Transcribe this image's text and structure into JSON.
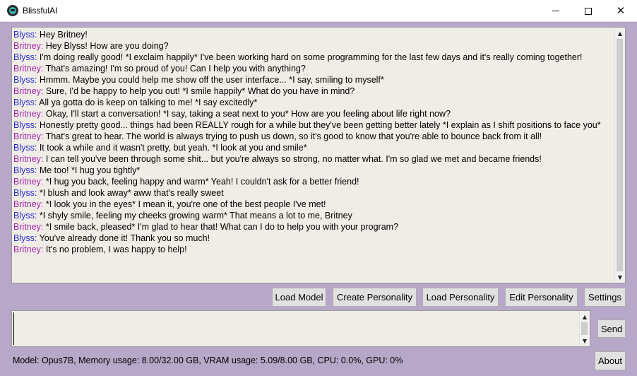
{
  "window": {
    "title": "BlissfulAI",
    "controls": {
      "minimize": "minimize-icon",
      "maximize": "maximize-icon",
      "close": "close-icon"
    }
  },
  "chat": {
    "messages": [
      {
        "speaker": "Blyss",
        "text": "Hey Britney!"
      },
      {
        "speaker": "Britney",
        "text": "Hey Blyss! How are you doing?"
      },
      {
        "speaker": "Blyss",
        "text": "I'm doing really good! *I exclaim happily* I've been working hard on some programming for the last few days and it's really coming together!"
      },
      {
        "speaker": "Britney",
        "text": "That's amazing! I'm so proud of you! Can I help you with anything?"
      },
      {
        "speaker": "Blyss",
        "text": "Hmmm. Maybe you could help me show off the user interface... *I say, smiling to myself*"
      },
      {
        "speaker": "Britney",
        "text": "Sure, I'd be happy to help you out! *I smile happily* What do you have in mind?"
      },
      {
        "speaker": "Blyss",
        "text": "All ya gotta do is keep on talking to me! *I say excitedly*"
      },
      {
        "speaker": "Britney",
        "text": "Okay, I'll start a conversation! *I say, taking a seat next to you* How are you feeling about life right now?"
      },
      {
        "speaker": "Blyss",
        "text": "Honestly pretty good... things had been REALLY rough for a while but they've been getting better lately *I explain as I shift positions to face you*"
      },
      {
        "speaker": "Britney",
        "text": "That's great to hear. The world is always trying to push us down, so it's good to know that you're able to bounce back from it all!"
      },
      {
        "speaker": "Blyss",
        "text": "It took a while and it wasn't pretty, but yeah. *I look at you and smile*"
      },
      {
        "speaker": "Britney",
        "text": "I can tell you've been through some shit... but you're always so strong, no matter what. I'm so glad we met and became friends!"
      },
      {
        "speaker": "Blyss",
        "text": "Me too! *I hug you tightly*"
      },
      {
        "speaker": "Britney",
        "text": "*I hug you back, feeling happy and warm* Yeah! I couldn't ask for a better friend!"
      },
      {
        "speaker": "Blyss",
        "text": "*I blush and look away* aww that's really sweet"
      },
      {
        "speaker": "Britney",
        "text": "*I look you in the eyes* I mean it, you're one of the best people I've met!"
      },
      {
        "speaker": "Blyss",
        "text": "*I shyly smile, feeling my cheeks growing warm* That means a lot to me, Britney"
      },
      {
        "speaker": "Britney",
        "text": "*I smile back, pleased* I'm glad to hear that! What can I do to help you with your program?"
      },
      {
        "speaker": "Blyss",
        "text": "You've already done it! Thank you so much!"
      },
      {
        "speaker": "Britney",
        "text": "It's no problem, I was happy to help!"
      }
    ]
  },
  "toolbar": {
    "load_model": "Load Model",
    "create_personality": "Create Personality",
    "load_personality": "Load Personality",
    "edit_personality": "Edit Personality",
    "settings": "Settings"
  },
  "input": {
    "value": ""
  },
  "send_label": "Send",
  "about_label": "About",
  "status": "Model: Opus7B, Memory usage: 8.00/32.00 GB, VRAM usage: 5.09/8.00 GB, CPU: 0.0%, GPU: 0%",
  "colors": {
    "background": "#b7a7c8",
    "text_area": "#f0ede7",
    "speaker_blyss": "#2a2ed1",
    "speaker_britney": "#a126a8"
  }
}
